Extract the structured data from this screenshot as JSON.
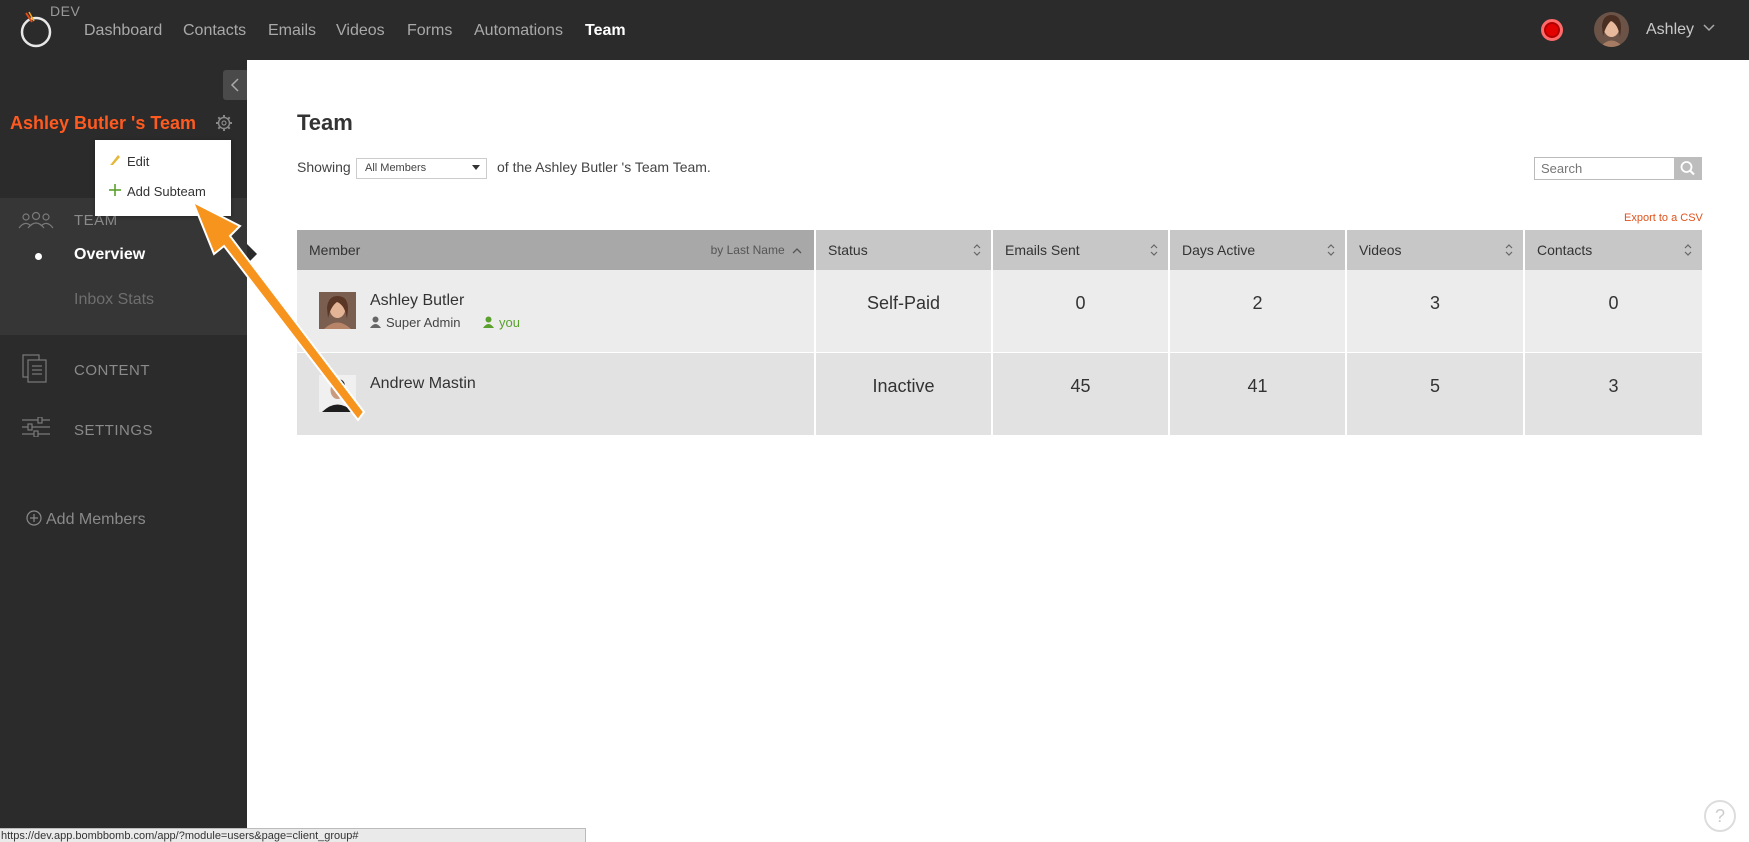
{
  "topnav": {
    "env_label": "DEV",
    "items": [
      {
        "label": "Dashboard",
        "active": false
      },
      {
        "label": "Contacts",
        "active": false
      },
      {
        "label": "Emails",
        "active": false
      },
      {
        "label": "Videos",
        "active": false
      },
      {
        "label": "Forms",
        "active": false
      },
      {
        "label": "Automations",
        "active": false
      },
      {
        "label": "Team",
        "active": true
      }
    ],
    "user_name": "Ashley",
    "record_color": "#e30000"
  },
  "sidebar": {
    "team_title": "Ashley Butler 's Team",
    "menu": {
      "edit_label": "Edit",
      "add_subteam_label": "Add Subteam"
    },
    "team_section_label": "TEAM",
    "overview_label": "Overview",
    "inbox_stats_label": "Inbox Stats",
    "content_label": "CONTENT",
    "settings_label": "SETTINGS",
    "add_members_label": "Add Members"
  },
  "main": {
    "title": "Team",
    "showing_label": "Showing",
    "filter_selected": "All Members",
    "of_team_text": "of the Ashley Butler 's Team Team.",
    "search_placeholder": "Search",
    "export_label": "Export to a CSV",
    "table": {
      "columns": [
        "Member",
        "Status",
        "Emails Sent",
        "Days Active",
        "Videos",
        "Contacts"
      ],
      "member_sort_label": "by Last Name",
      "rows": [
        {
          "name": "Ashley Butler",
          "role": "Super Admin",
          "you": "you",
          "status": "Self-Paid",
          "emails_sent": "0",
          "days_active": "2",
          "videos": "3",
          "contacts": "0"
        },
        {
          "name": "Andrew Mastin",
          "role": "",
          "you": "",
          "status": "Inactive",
          "emails_sent": "45",
          "days_active": "41",
          "videos": "5",
          "contacts": "3"
        }
      ]
    }
  },
  "status_bar_url": "https://dev.app.bombbomb.com/app/?module=users&page=client_group#",
  "help_label": "?",
  "colors": {
    "accent_orange": "#ff5a1f",
    "annotation_arrow": "#f7941d",
    "you_green": "#5aa02c"
  }
}
